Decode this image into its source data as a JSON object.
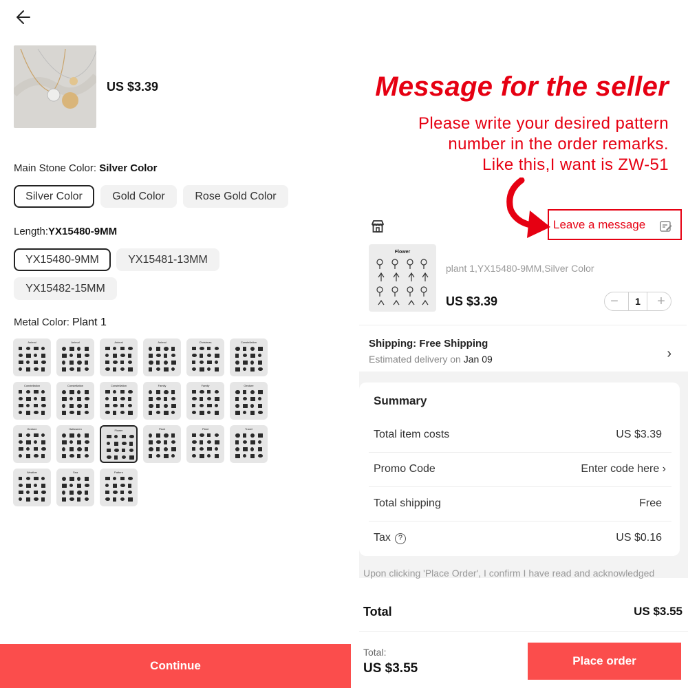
{
  "icons": {
    "back": "arrow-left-icon",
    "store": "store-icon",
    "edit": "edit-note-icon",
    "chevron": "chevron-right-icon",
    "tax_info": "question-circle-icon"
  },
  "colors": {
    "accent": "#fb4d4c",
    "promo_red": "#e60012",
    "selected_border": "#222222"
  },
  "product": {
    "price": "US $3.39"
  },
  "options": {
    "stone": {
      "label": "Main Stone Color:",
      "selected": "Silver Color",
      "choices": [
        "Silver Color",
        "Gold Color",
        "Rose Gold Color"
      ]
    },
    "length": {
      "label": "Length:",
      "selected": "YX15480-9MM",
      "choices": [
        "YX15480-9MM",
        "YX15481-13MM",
        "YX15482-15MM"
      ]
    },
    "metal": {
      "label": "Metal Color:",
      "selected": "Plant 1",
      "tiles": [
        "Animal",
        "Animal",
        "Animal",
        "Animal",
        "Christmas",
        "Constellation",
        "Constellation",
        "Constellation",
        "Constellation",
        "Family",
        "Family",
        "Gesture",
        "Gesture",
        "Halloween",
        "Flower",
        "Plant",
        "Plant",
        "Travel",
        "Weather",
        "Sea",
        "Pattern"
      ]
    }
  },
  "left_footer": {
    "continue_label": "Continue"
  },
  "promo": {
    "heading": "Message for the seller",
    "lines": [
      "Please write your desired pattern",
      "number in the order remarks.",
      "Like this,I want is ZW-51"
    ]
  },
  "order": {
    "leave_message": "Leave a message",
    "item": {
      "image_title": "Flower",
      "description": "plant 1,YX15480-9MM,Silver Color",
      "price": "US $3.39",
      "quantity": "1",
      "minus": "−",
      "plus": "+"
    },
    "shipping": {
      "title": "Shipping: Free Shipping",
      "estimate_prefix": "Estimated delivery on",
      "estimate_date": "Jan 09",
      "chevron": "›"
    }
  },
  "summary": {
    "title": "Summary",
    "item_costs_label": "Total item costs",
    "item_costs_value": "US $3.39",
    "promo_label": "Promo Code",
    "promo_value": "Enter code here ›",
    "shipping_label": "Total shipping",
    "shipping_value": "Free",
    "tax_label": "Tax",
    "tax_icon": "?",
    "tax_value": "US $0.16"
  },
  "disclaimer": "Upon clicking 'Place Order', I confirm I have read and acknowledged",
  "total": {
    "label": "Total",
    "value": "US $3.55"
  },
  "bottom": {
    "total_label": "Total:",
    "total_value": "US $3.55",
    "place_order": "Place order"
  }
}
